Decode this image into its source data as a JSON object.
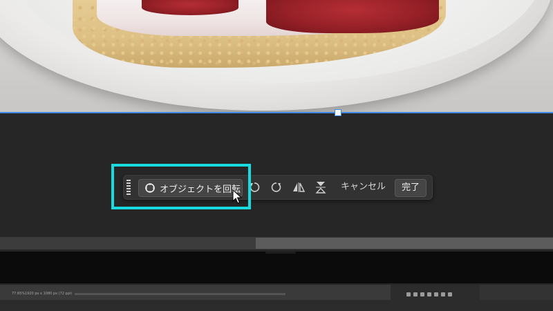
{
  "canvas": {
    "photo_subject": "cake-slice-on-plate",
    "selection_color": "#3b88e6"
  },
  "taskbar": {
    "rotate_object_label": "オブジェクトを回転",
    "cancel_label": "キャンセル",
    "done_label": "完了"
  },
  "highlight": {
    "color": "#18dbe0"
  },
  "statusbar": {
    "zoom": "77.65%",
    "doc_info": "1920 px x 1080 px (72 ppi)"
  },
  "icons": {
    "rotate_object": "rotate-arrows-icon",
    "rotate_ccw": "rotate-counterclockwise-icon",
    "rotate_cw": "rotate-clockwise-icon",
    "flip_h": "flip-horizontal-icon",
    "flip_v": "flip-vertical-icon"
  }
}
